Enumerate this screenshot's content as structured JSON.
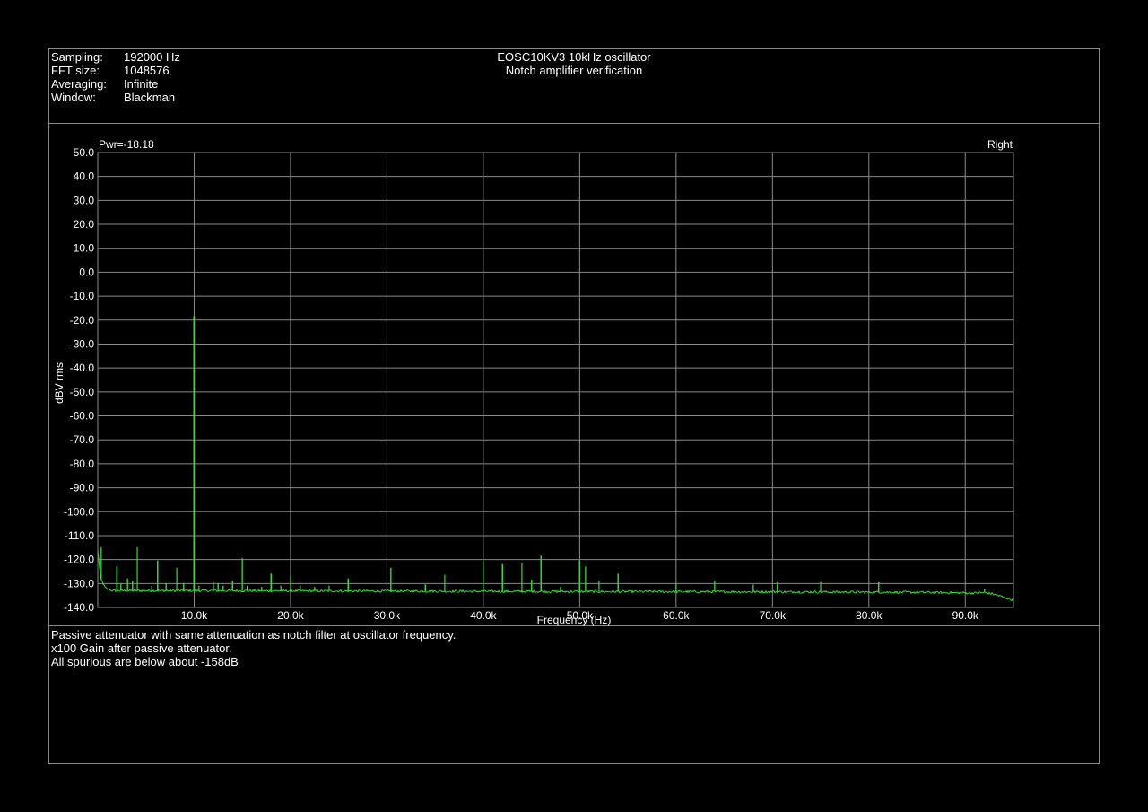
{
  "info": [
    {
      "label": "Sampling:",
      "value": "192000 Hz"
    },
    {
      "label": "FFT size:",
      "value": "1048576"
    },
    {
      "label": "Averaging:",
      "value": "Infinite"
    },
    {
      "label": "Window:",
      "value": "Blackman"
    }
  ],
  "title": {
    "line1": "EOSC10KV3 10kHz oscillator",
    "line2": "Notch amplifier verification"
  },
  "notes": [
    "Passive attenuator with same attenuation as notch filter at oscillator frequency.",
    "x100 Gain after passive attenuator.",
    "All spurious are below about -158dB"
  ],
  "colors": {
    "background": "#000000",
    "trace": "#33dd33",
    "grid": "#8a8a8a",
    "text": "#ffffff"
  },
  "chart_data": {
    "type": "line",
    "pwr_label": "Pwr=-18.18",
    "channel_label": "Right",
    "xlabel": "Frequency (Hz)",
    "ylabel": "dBV rms",
    "xlim": [
      0,
      95000
    ],
    "ylim": [
      -140,
      50
    ],
    "yticks": [
      "50.0",
      "40.0",
      "30.0",
      "20.0",
      "10.0",
      "0.0",
      "-10.0",
      "-20.0",
      "-30.0",
      "-40.0",
      "-50.0",
      "-60.0",
      "-70.0",
      "-80.0",
      "-90.0",
      "-100.0",
      "-110.0",
      "-120.0",
      "-130.0",
      "-140.0"
    ],
    "xticks": [
      {
        "value": 10000,
        "label": "10.0k"
      },
      {
        "value": 20000,
        "label": "20.0k"
      },
      {
        "value": 30000,
        "label": "30.0k"
      },
      {
        "value": 40000,
        "label": "40.0k"
      },
      {
        "value": 50000,
        "label": "50.0k"
      },
      {
        "value": 60000,
        "label": "60.0k"
      },
      {
        "value": 70000,
        "label": "70.0k"
      },
      {
        "value": 80000,
        "label": "80.0k"
      },
      {
        "value": 90000,
        "label": "90.0k"
      }
    ],
    "grid": true,
    "series": [
      {
        "noise_floor": [
          [
            0,
            -116
          ],
          [
            300,
            -128
          ],
          [
            800,
            -132
          ],
          [
            1500,
            -133
          ],
          [
            10000,
            -133
          ],
          [
            30000,
            -133.2
          ],
          [
            50000,
            -133.4
          ],
          [
            70000,
            -133.5
          ],
          [
            85000,
            -133.7
          ],
          [
            91000,
            -134
          ],
          [
            92000,
            -133.8
          ],
          [
            93000,
            -134.5
          ],
          [
            95000,
            -137
          ]
        ],
        "peaks": [
          {
            "f": 350,
            "db": -115
          },
          {
            "f": 2000,
            "db": -123
          },
          {
            "f": 2400,
            "db": -130
          },
          {
            "f": 3100,
            "db": -128
          },
          {
            "f": 3600,
            "db": -129
          },
          {
            "f": 4100,
            "db": -115
          },
          {
            "f": 5600,
            "db": -131
          },
          {
            "f": 6200,
            "db": -120.5
          },
          {
            "f": 7100,
            "db": -130
          },
          {
            "f": 8200,
            "db": -123.5
          },
          {
            "f": 8900,
            "db": -130
          },
          {
            "f": 10000,
            "db": -18.5
          },
          {
            "f": 10500,
            "db": -131
          },
          {
            "f": 12000,
            "db": -129.5
          },
          {
            "f": 12500,
            "db": -130
          },
          {
            "f": 13000,
            "db": -131
          },
          {
            "f": 14000,
            "db": -129
          },
          {
            "f": 15000,
            "db": -119.5
          },
          {
            "f": 15500,
            "db": -131
          },
          {
            "f": 17000,
            "db": -131.5
          },
          {
            "f": 18000,
            "db": -126
          },
          {
            "f": 19000,
            "db": -131
          },
          {
            "f": 20000,
            "db": -127
          },
          {
            "f": 21000,
            "db": -131
          },
          {
            "f": 22500,
            "db": -131.5
          },
          {
            "f": 24000,
            "db": -131
          },
          {
            "f": 26000,
            "db": -128
          },
          {
            "f": 30400,
            "db": -123.5
          },
          {
            "f": 34000,
            "db": -130.5
          },
          {
            "f": 36000,
            "db": -126.5
          },
          {
            "f": 40000,
            "db": -120.5
          },
          {
            "f": 42000,
            "db": -122
          },
          {
            "f": 44000,
            "db": -121.5
          },
          {
            "f": 45000,
            "db": -128.5
          },
          {
            "f": 46000,
            "db": -118.5
          },
          {
            "f": 48000,
            "db": -131.5
          },
          {
            "f": 50000,
            "db": -120.5
          },
          {
            "f": 50600,
            "db": -123
          },
          {
            "f": 52000,
            "db": -129
          },
          {
            "f": 54000,
            "db": -126
          },
          {
            "f": 60000,
            "db": -130
          },
          {
            "f": 64000,
            "db": -129
          },
          {
            "f": 68000,
            "db": -130.5
          },
          {
            "f": 70500,
            "db": -129.5
          },
          {
            "f": 75000,
            "db": -129.5
          },
          {
            "f": 81000,
            "db": -129.5
          },
          {
            "f": 92000,
            "db": -132.5
          }
        ]
      }
    ]
  }
}
